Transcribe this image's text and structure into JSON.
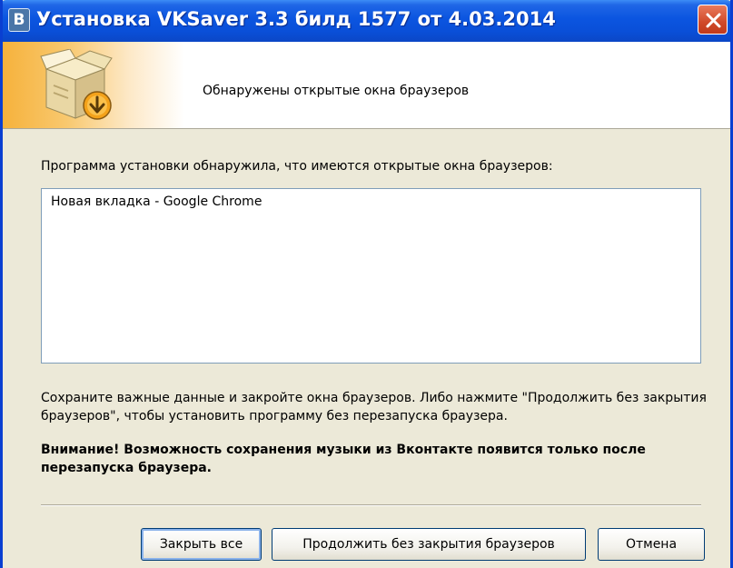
{
  "window": {
    "icon_letter": "B",
    "title": "Установка VKSaver 3.3 билд 1577 от 4.03.2014",
    "close_icon": "close-icon"
  },
  "banner": {
    "icon": "install-box-icon",
    "heading": "Обнаружены открытые окна браузеров"
  },
  "body": {
    "intro": "Программа установки обнаружила, что имеются открытые окна браузеров:",
    "browsers": [
      "Новая вкладка - Google Chrome"
    ],
    "note": "Сохраните важные данные и закройте окна браузеров. Либо нажмите \"Продолжить без закрытия браузеров\", чтобы установить программу без перезапуска браузера.",
    "warning": "Внимание! Возможность сохранения музыки из Вконтакте появится только после перезапуска браузера."
  },
  "buttons": {
    "close_all": "Закрыть все",
    "continue": "Продолжить без закрытия браузеров",
    "cancel": "Отмена"
  }
}
